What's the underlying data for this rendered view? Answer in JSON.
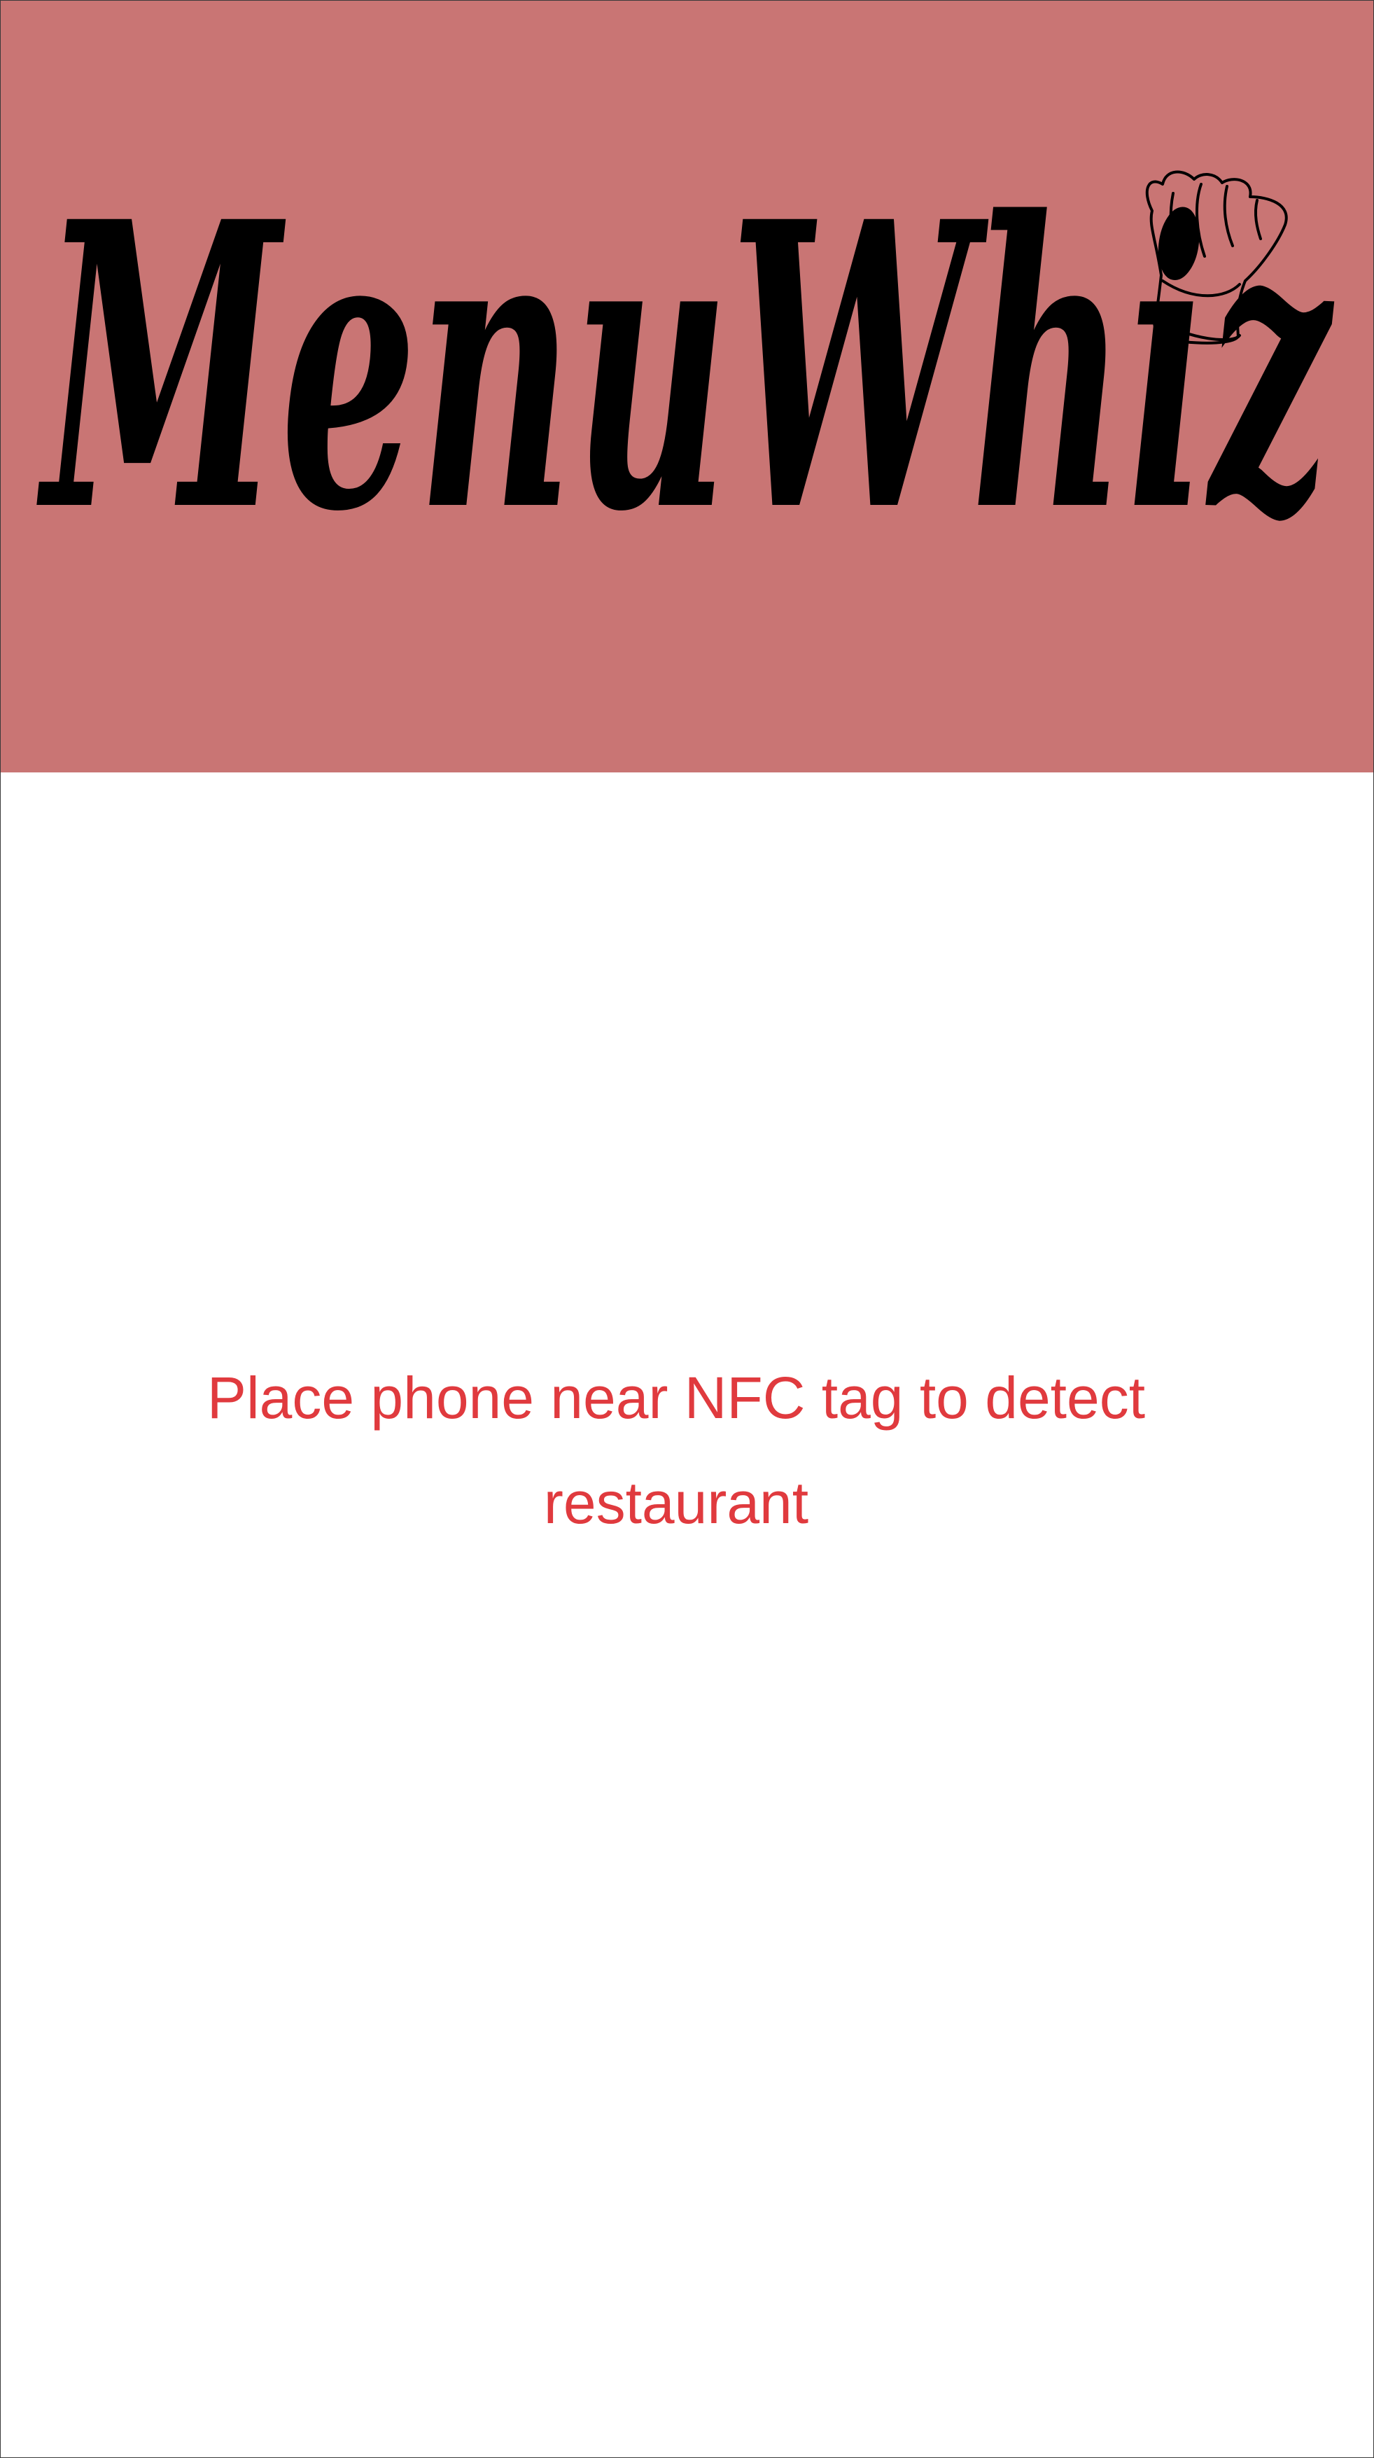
{
  "app": {
    "logo_text": "MenuWhiz",
    "logo_icon": "chef-hat-icon"
  },
  "colors": {
    "header_background": "#c97574",
    "message_text": "#e03a3e",
    "logo_text": "#000000"
  },
  "main": {
    "nfc_prompt": "Place phone near NFC tag to detect restaurant"
  }
}
